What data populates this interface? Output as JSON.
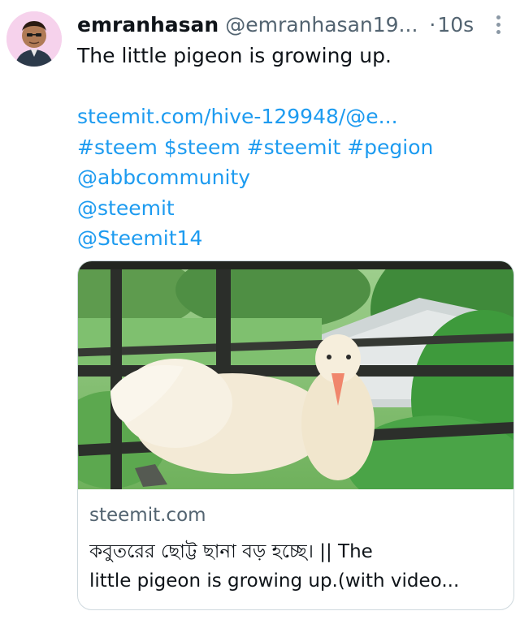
{
  "tweet": {
    "display_name": "emranhasan",
    "handle": "@emranhasan19...",
    "separator": "·",
    "time": "10s",
    "text": "The little pigeon is growing up.",
    "link": "steemit.com/hive-129948/@e...",
    "hashtags": "#steem $steem #steemit #pegion",
    "mentions": [
      "@abbcommunity",
      "@steemit",
      "@Steemit14"
    ]
  },
  "card": {
    "domain": "steemit.com",
    "title_line1": "কবুতরের ছোট্ট ছানা বড় হচ্ছে। || The",
    "title_line2": "little pigeon is growing up.(with video..."
  },
  "icons": {
    "avatar": "avatar-icon",
    "more": "more-vertical-icon"
  },
  "colors": {
    "link": "#1d9bf0",
    "text": "#0f1419",
    "secondary": "#536471",
    "border": "#cfd9de"
  }
}
